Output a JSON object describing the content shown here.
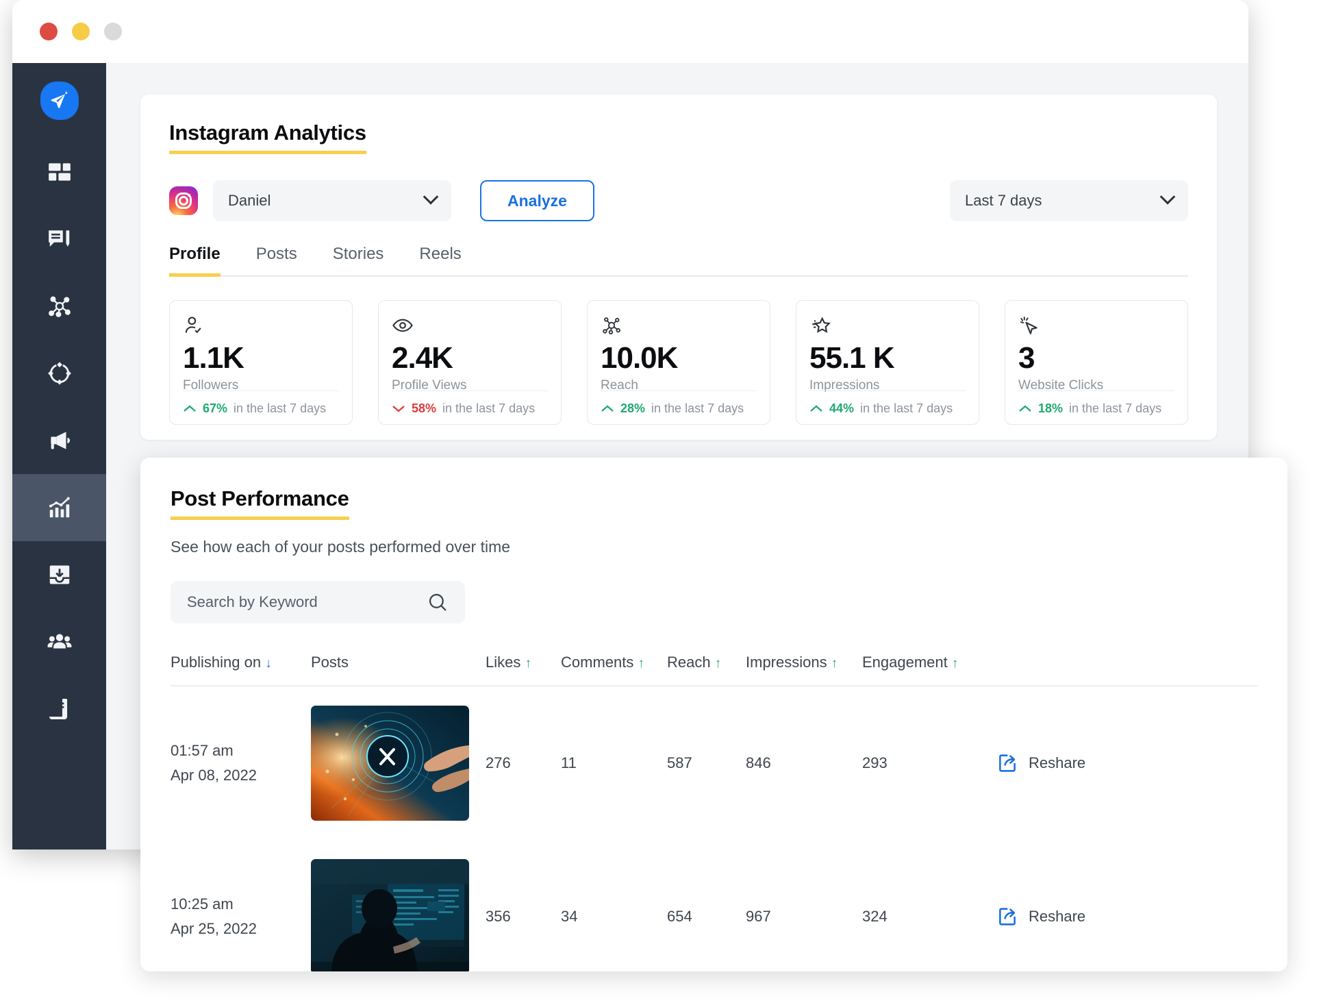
{
  "window": {
    "traffic_lights": [
      "close",
      "minimize",
      "maximize"
    ]
  },
  "sidebar": {
    "items": [
      {
        "name": "logo",
        "icon": "paper-plane-icon",
        "active": false
      },
      {
        "name": "dashboard",
        "icon": "dashboard-grid-icon",
        "active": false
      },
      {
        "name": "engage",
        "icon": "comment-compose-icon",
        "active": false
      },
      {
        "name": "network",
        "icon": "share-network-icon",
        "active": false
      },
      {
        "name": "discovery",
        "icon": "orbit-nodes-icon",
        "active": false
      },
      {
        "name": "campaigns",
        "icon": "megaphone-icon",
        "active": false
      },
      {
        "name": "analytics",
        "icon": "bar-chart-trend-icon",
        "active": true
      },
      {
        "name": "inbox",
        "icon": "inbox-download-icon",
        "active": false
      },
      {
        "name": "team",
        "icon": "people-group-icon",
        "active": false
      },
      {
        "name": "reports",
        "icon": "document-lines-icon",
        "active": false
      }
    ]
  },
  "analytics": {
    "title": "Instagram Analytics",
    "account_select": {
      "platform_icon": "instagram-icon",
      "value": "Daniel",
      "chevron": "chevron-down-icon"
    },
    "analyze_button": "Analyze",
    "date_range": {
      "value": "Last 7 days",
      "chevron": "chevron-down-icon"
    },
    "tabs": [
      {
        "label": "Profile",
        "active": true
      },
      {
        "label": "Posts",
        "active": false
      },
      {
        "label": "Stories",
        "active": false
      },
      {
        "label": "Reels",
        "active": false
      }
    ],
    "metrics": [
      {
        "icon": "user-check-icon",
        "value": "1.1K",
        "label": "Followers",
        "direction": "up",
        "delta": "67%",
        "delta_suffix": "in the last 7 days"
      },
      {
        "icon": "eye-icon",
        "value": "2.4K",
        "label": "Profile Views",
        "direction": "down",
        "delta": "58%",
        "delta_suffix": "in the last 7 days"
      },
      {
        "icon": "share-nodes-icon",
        "value": "10.0K",
        "label": "Reach",
        "direction": "up",
        "delta": "28%",
        "delta_suffix": "in the last 7 days"
      },
      {
        "icon": "star-motion-icon",
        "value": "55.1 K",
        "label": "Impressions",
        "direction": "up",
        "delta": "44%",
        "delta_suffix": "in the last 7 days"
      },
      {
        "icon": "click-cursor-icon",
        "value": "3",
        "label": "Website Clicks",
        "direction": "up",
        "delta": "18%",
        "delta_suffix": "in the last 7 days"
      }
    ]
  },
  "post_performance": {
    "title": "Post Performance",
    "subtitle": "See how each of your posts performed over time",
    "search": {
      "placeholder": "Search by Keyword",
      "icon": "search-icon"
    },
    "columns": [
      {
        "label": "Publishing on",
        "sort": "down",
        "sort_color": "#1a73e8"
      },
      {
        "label": "Posts",
        "sort": "none",
        "sort_color": ""
      },
      {
        "label": "Likes",
        "sort": "up",
        "sort_color": "#1fa971"
      },
      {
        "label": "Comments",
        "sort": "up",
        "sort_color": "#1fa971"
      },
      {
        "label": "Reach",
        "sort": "up",
        "sort_color": "#1fa971"
      },
      {
        "label": "Impressions",
        "sort": "up",
        "sort_color": "#1fa971"
      },
      {
        "label": "Engagement",
        "sort": "up",
        "sort_color": "#1fa971"
      }
    ],
    "rows": [
      {
        "time": "01:57 am",
        "date": "Apr 08, 2022",
        "thumbnail": "tech-hand-touching-hud-interface",
        "likes": "276",
        "comments": "11",
        "reach": "587",
        "impressions": "846",
        "engagement": "293",
        "action": {
          "label": "Reshare",
          "icon": "reshare-icon"
        }
      },
      {
        "time": "10:25 am",
        "date": "Apr 25, 2022",
        "thumbnail": "hooded-hacker-at-monitors",
        "likes": "356",
        "comments": "34",
        "reach": "654",
        "impressions": "967",
        "engagement": "324",
        "action": {
          "label": "Reshare",
          "icon": "reshare-icon"
        }
      }
    ]
  },
  "colors": {
    "accent_yellow": "#f8cf4e",
    "accent_blue": "#1a73e8",
    "sidebar_bg": "#2a3342",
    "positive": "#1fa971",
    "negative": "#df3b3b",
    "canvas_bg": "#f4f5f7"
  }
}
